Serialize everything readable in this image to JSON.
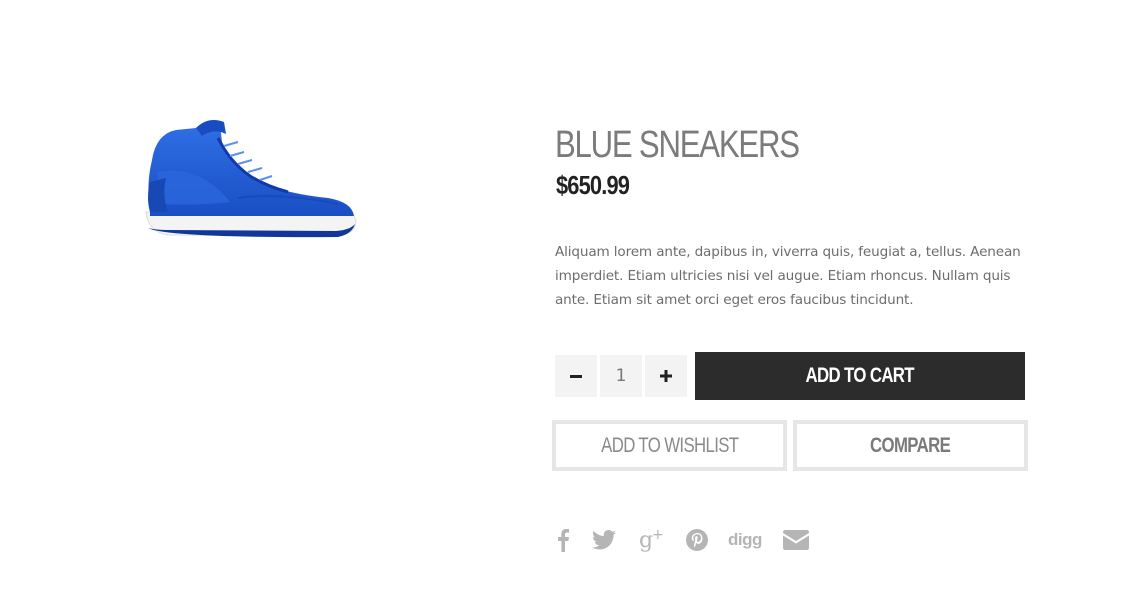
{
  "product": {
    "title": "BLUE SNEAKERS",
    "price": "$650.99",
    "description": "Aliquam lorem ante, dapibus in, viverra quis, feugiat a, tellus. Aenean imperdiet. Etiam ultricies nisi vel augue. Etiam rhoncus. Nullam quis ante. Etiam sit amet orci eget eros faucibus tincidunt.",
    "image_icon": "blue-high-top-sneaker"
  },
  "quantity": {
    "value": "1",
    "minus_icon": "minus-icon",
    "plus_icon": "plus-icon"
  },
  "actions": {
    "add_to_cart": "ADD TO CART",
    "add_to_wishlist": "ADD TO WISHLIST",
    "compare": "COMPARE"
  },
  "share": {
    "icons": [
      "facebook-icon",
      "twitter-icon",
      "google-plus-icon",
      "pinterest-icon",
      "digg-icon",
      "email-icon"
    ],
    "digg_label": "digg"
  },
  "colors": {
    "sneaker_blue": "#1f5fd6",
    "button_dark": "#2c2c2c",
    "icon_gray": "#b5b5b5",
    "border_gray": "#e6e6e6"
  }
}
